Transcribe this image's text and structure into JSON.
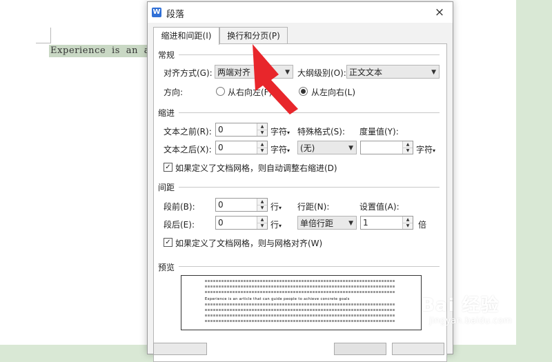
{
  "document": {
    "text": "Experience is an article"
  },
  "dialog": {
    "title": "段落",
    "close_symbol": "×",
    "app_icon_letter": "W",
    "tabs": [
      {
        "label": "缩进和间距(I)",
        "active": true
      },
      {
        "label": "换行和分页(P)",
        "active": false
      }
    ],
    "general": {
      "heading": "常规",
      "alignment_label": "对齐方式(G):",
      "alignment_value": "两端对齐",
      "outline_label": "大纲级别(O):",
      "outline_value": "正文文本",
      "direction_label": "方向:",
      "direction_rtl": "从右向左(F)",
      "direction_ltr": "从左向右(L)",
      "direction_selected": "ltr"
    },
    "indent": {
      "heading": "缩进",
      "before_label": "文本之前(R):",
      "before_value": "0",
      "before_unit": "字符",
      "after_label": "文本之后(X):",
      "after_value": "0",
      "after_unit": "字符",
      "special_label": "特殊格式(S):",
      "special_value": "(无)",
      "measure_label": "度量值(Y):",
      "measure_value": "",
      "measure_unit": "字符",
      "grid_checkbox_label": "如果定义了文档网格，则自动调整右缩进(D)",
      "grid_checked": true
    },
    "spacing": {
      "heading": "间距",
      "before_label": "段前(B):",
      "before_value": "0",
      "before_unit": "行",
      "after_label": "段后(E):",
      "after_value": "0",
      "after_unit": "行",
      "line_spacing_label": "行距(N):",
      "line_spacing_value": "单倍行距",
      "set_value_label": "设置值(A):",
      "set_value": "1",
      "set_value_unit": "倍",
      "grid_checkbox_label": "如果定义了文档网格，则与网格对齐(W)",
      "grid_checked": true
    },
    "preview": {
      "heading": "预览",
      "sample_text": "Experience is an article that can guide people to achieve concrete goals"
    }
  },
  "watermark": {
    "logo_text": "Bai 经验",
    "url": "jingyan.baidu.com"
  },
  "colors": {
    "annotation_arrow": "#e8262b",
    "background_green": "#d9e8d5",
    "selection": "#c9d8c4"
  }
}
